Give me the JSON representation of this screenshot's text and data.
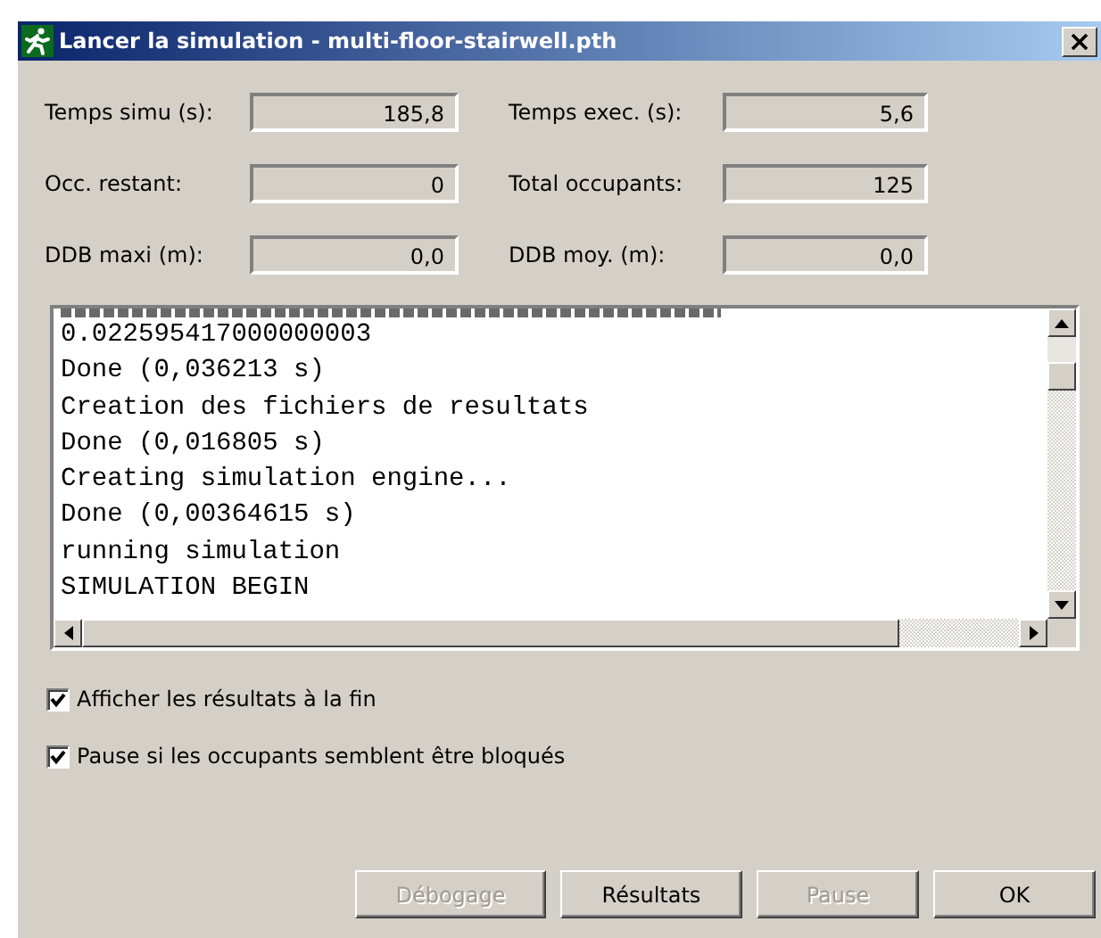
{
  "window": {
    "title": "Lancer la simulation - multi-floor-stairwell.pth"
  },
  "fields": [
    {
      "label": "Temps simu (s):",
      "value": "185,8"
    },
    {
      "label": "Temps exec. (s):",
      "value": "5,6"
    },
    {
      "label": "Occ. restant:",
      "value": "0"
    },
    {
      "label": "Total occupants:",
      "value": "125"
    },
    {
      "label": "DDB maxi (m):",
      "value": "0,0"
    },
    {
      "label": "DDB moy. (m):",
      "value": "0,0"
    }
  ],
  "log": [
    "0.022595417000000003",
    "Done (0,036213 s)",
    "Creation des fichiers de resultats",
    "Done (0,016805 s)",
    "Creating simulation engine...",
    "Done (0,00364615 s)",
    "running simulation",
    "SIMULATION BEGIN"
  ],
  "checkboxes": [
    {
      "label": "Afficher les résultats à la fin",
      "checked": true
    },
    {
      "label": "Pause si les occupants semblent être bloqués",
      "checked": true
    }
  ],
  "buttons": [
    {
      "label": "Débogage",
      "disabled": true
    },
    {
      "label": "Résultats",
      "disabled": false
    },
    {
      "label": "Pause",
      "disabled": true
    },
    {
      "label": "OK",
      "disabled": false
    }
  ]
}
